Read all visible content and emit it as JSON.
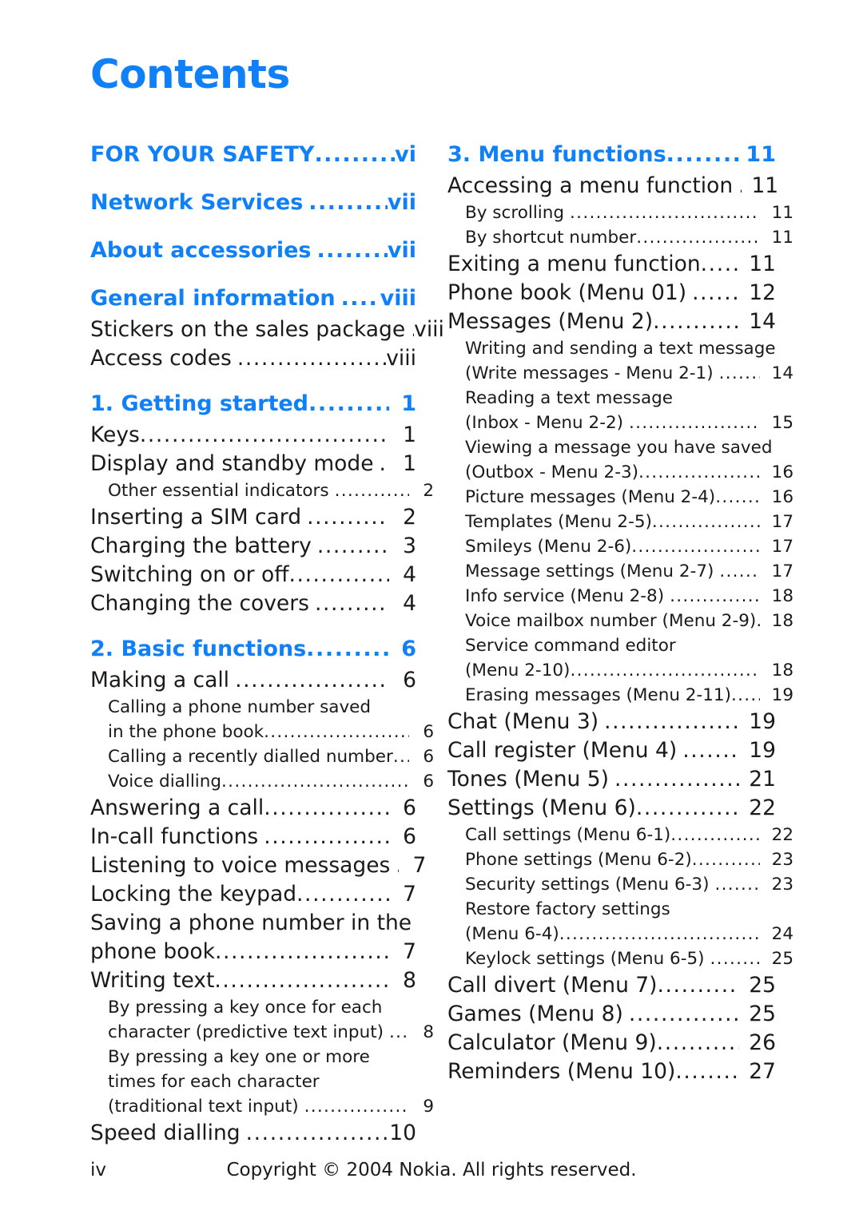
{
  "document": {
    "title": "Contents",
    "accent_color": "#1080f8",
    "text_color": "#1a1a1a"
  },
  "footer": {
    "folio": "iv",
    "copyright": "Copyright © 2004 Nokia. All rights reserved."
  },
  "toc": {
    "left_column": [
      {
        "level": 1,
        "text": "FOR YOUR SAFETY",
        "page": "vi",
        "gap": "narrow"
      },
      {
        "level": 1,
        "text": "Network Services",
        "page": "vii",
        "gap": "wide"
      },
      {
        "level": 1,
        "text": "About accessories",
        "page": "vii",
        "gap": "wide"
      },
      {
        "level": 1,
        "text": "General information",
        "page": "viii",
        "gap": "wide"
      },
      {
        "level": 2,
        "text": "Stickers on the sales package",
        "page": "viii",
        "gap": "wide"
      },
      {
        "level": 2,
        "text": "Access codes",
        "page": "viii",
        "gap": "wide"
      },
      {
        "level": 1,
        "text": "1. Getting started",
        "page": "1",
        "gap": "narrow"
      },
      {
        "level": 2,
        "text": "Keys",
        "page": "1",
        "gap": "narrow"
      },
      {
        "level": 2,
        "text": "Display and standby mode",
        "page": "1",
        "gap": "wide"
      },
      {
        "level": 3,
        "text": "Other essential indicators",
        "page": "2",
        "gap": "wide"
      },
      {
        "level": 2,
        "text": "Inserting a SIM card",
        "page": "2",
        "gap": "wide"
      },
      {
        "level": 2,
        "text": "Charging the battery",
        "page": "3",
        "gap": "wide"
      },
      {
        "level": 2,
        "text": "Switching on or off",
        "page": "4",
        "gap": "narrow"
      },
      {
        "level": 2,
        "text": "Changing the covers",
        "page": "4",
        "gap": "wide"
      },
      {
        "level": 1,
        "text": "2. Basic functions",
        "page": "6",
        "gap": "narrow"
      },
      {
        "level": 2,
        "text": "Making a call",
        "page": "6",
        "gap": "wide"
      },
      {
        "level": 3,
        "lines": [
          "Calling a phone number saved"
        ],
        "text": "in the phone book",
        "page": "6",
        "gap": "narrow"
      },
      {
        "level": 3,
        "text": "Calling a recently dialled number",
        "page": "6",
        "gap": "narrow"
      },
      {
        "level": 3,
        "text": "Voice dialling",
        "page": "6",
        "gap": "narrow"
      },
      {
        "level": 2,
        "text": "Answering a call",
        "page": "6",
        "gap": "narrow"
      },
      {
        "level": 2,
        "text": "In-call functions",
        "page": "6",
        "gap": "wide"
      },
      {
        "level": 2,
        "text": "Listening to voice messages",
        "page": "7",
        "gap": "wide"
      },
      {
        "level": 2,
        "text": "Locking the keypad",
        "page": "7",
        "gap": "narrow"
      },
      {
        "level": 2,
        "lines": [
          "Saving a phone number in the"
        ],
        "text": "phone book",
        "page": "7",
        "gap": "narrow"
      },
      {
        "level": 2,
        "text": "Writing text",
        "page": "8",
        "gap": "narrow"
      },
      {
        "level": 3,
        "lines": [
          "By pressing a key once for each"
        ],
        "text": "character (predictive text input)",
        "page": "8",
        "gap": "wide"
      },
      {
        "level": 3,
        "lines": [
          "By pressing a key one or more",
          "times for each character"
        ],
        "text": "(traditional text input)",
        "page": "9",
        "gap": "wide"
      },
      {
        "level": 2,
        "text": "Speed dialling",
        "page": "10",
        "gap": "wide"
      }
    ],
    "right_column": [
      {
        "level": 1,
        "text": "3. Menu functions",
        "page": "11",
        "gap": "narrow"
      },
      {
        "level": 2,
        "text": "Accessing a menu function",
        "page": "11",
        "gap": "wide"
      },
      {
        "level": 3,
        "text": "By scrolling",
        "page": "11",
        "gap": "wide"
      },
      {
        "level": 3,
        "text": "By shortcut number",
        "page": "11",
        "gap": "narrow"
      },
      {
        "level": 2,
        "text": "Exiting a menu function",
        "page": "11",
        "gap": "narrow"
      },
      {
        "level": 2,
        "text": "Phone book (Menu 01)",
        "page": "12",
        "gap": "wide"
      },
      {
        "level": 2,
        "text": "Messages (Menu 2)",
        "page": "14",
        "gap": "narrow"
      },
      {
        "level": 3,
        "lines": [
          "Writing and sending a text message"
        ],
        "text": "(Write messages - Menu 2-1)",
        "page": "14",
        "gap": "wide"
      },
      {
        "level": 3,
        "lines": [
          "Reading a text message"
        ],
        "text": "(Inbox - Menu 2-2)",
        "page": "15",
        "gap": "wide"
      },
      {
        "level": 3,
        "lines": [
          "Viewing a message you have saved"
        ],
        "text": "(Outbox - Menu 2-3)",
        "page": "16",
        "gap": "narrow"
      },
      {
        "level": 3,
        "text": "Picture messages (Menu 2-4)",
        "page": "16",
        "gap": "narrow"
      },
      {
        "level": 3,
        "text": "Templates (Menu 2-5)",
        "page": "17",
        "gap": "narrow"
      },
      {
        "level": 3,
        "text": "Smileys (Menu 2-6)",
        "page": "17",
        "gap": "narrow"
      },
      {
        "level": 3,
        "text": "Message settings (Menu 2-7)",
        "page": "17",
        "gap": "wide"
      },
      {
        "level": 3,
        "text": "Info service (Menu 2-8)",
        "page": "18",
        "gap": "wide"
      },
      {
        "level": 3,
        "text": "Voice mailbox number (Menu 2-9)",
        "page": "18",
        "gap": "narrow"
      },
      {
        "level": 3,
        "lines": [
          "Service command editor"
        ],
        "text": "(Menu 2-10)",
        "page": "18",
        "gap": "narrow"
      },
      {
        "level": 3,
        "text": "Erasing messages (Menu 2-11)",
        "page": "19",
        "gap": "narrow"
      },
      {
        "level": 2,
        "text": "Chat (Menu 3)",
        "page": "19",
        "gap": "wide"
      },
      {
        "level": 2,
        "text": "Call register (Menu 4)",
        "page": "19",
        "gap": "wide"
      },
      {
        "level": 2,
        "text": "Tones (Menu 5)",
        "page": "21",
        "gap": "wide"
      },
      {
        "level": 2,
        "text": "Settings (Menu 6)",
        "page": "22",
        "gap": "narrow"
      },
      {
        "level": 3,
        "text": "Call settings (Menu 6-1)",
        "page": "22",
        "gap": "narrow"
      },
      {
        "level": 3,
        "text": "Phone settings (Menu 6-2)",
        "page": "23",
        "gap": "narrow"
      },
      {
        "level": 3,
        "text": "Security settings (Menu 6-3)",
        "page": "23",
        "gap": "wide"
      },
      {
        "level": 3,
        "lines": [
          "Restore factory settings"
        ],
        "text": "(Menu 6-4)",
        "page": "24",
        "gap": "narrow"
      },
      {
        "level": 3,
        "text": "Keylock settings (Menu 6-5)",
        "page": "25",
        "gap": "wide"
      },
      {
        "level": 2,
        "text": "Call divert (Menu 7)",
        "page": "25",
        "gap": "narrow"
      },
      {
        "level": 2,
        "text": "Games (Menu 8)",
        "page": "25",
        "gap": "wide"
      },
      {
        "level": 2,
        "text": "Calculator (Menu 9)",
        "page": "26",
        "gap": "narrow"
      },
      {
        "level": 2,
        "text": "Reminders (Menu 10)",
        "page": "27",
        "gap": "narrow"
      }
    ]
  }
}
